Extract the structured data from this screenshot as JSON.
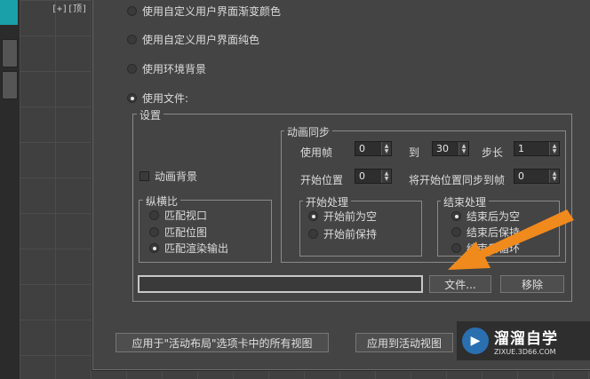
{
  "viewport": {
    "label": "[+][顶]"
  },
  "environment": {
    "options": [
      {
        "label": "使用自定义用户界面渐变颜色",
        "selected": false
      },
      {
        "label": "使用自定义用户界面纯色",
        "selected": false
      },
      {
        "label": "使用环境背景",
        "selected": false
      },
      {
        "label": "使用文件:",
        "selected": true
      }
    ]
  },
  "settings": {
    "legend": "设置",
    "animate_bg": {
      "label": "动画背景",
      "checked": false
    },
    "aspect": {
      "legend": "纵横比",
      "options": [
        {
          "label": "匹配视口",
          "selected": false
        },
        {
          "label": "匹配位图",
          "selected": false
        },
        {
          "label": "匹配渲染输出",
          "selected": true
        }
      ]
    },
    "anim_sync": {
      "legend": "动画同步",
      "use_frame_label": "使用帧",
      "use_frame_value": "0",
      "to_label": "到",
      "to_value": "30",
      "step_label": "步长",
      "step_value": "1",
      "start_label": "开始位置",
      "start_value": "0",
      "sync_label": "将开始位置同步到帧",
      "sync_value": "0"
    },
    "start_proc": {
      "legend": "开始处理",
      "options": [
        {
          "label": "开始前为空",
          "selected": true
        },
        {
          "label": "开始前保持",
          "selected": false
        }
      ]
    },
    "end_proc": {
      "legend": "结束处理",
      "options": [
        {
          "label": "结束后为空",
          "selected": true
        },
        {
          "label": "结束后保持",
          "selected": false
        },
        {
          "label": "结束后循环",
          "selected": false
        }
      ]
    },
    "file_path": "",
    "file_button": "文件...",
    "remove_button": "移除"
  },
  "footer": {
    "apply_all": "应用于\"活动布局\"选项卡中的所有视图",
    "apply_active": "应用到活动视图"
  },
  "watermark": {
    "title": "溜溜自学",
    "url": "ZIXUE.3D66.COM"
  },
  "colors": {
    "arrow": "#f08a1c",
    "accent": "#1aa0a8"
  }
}
